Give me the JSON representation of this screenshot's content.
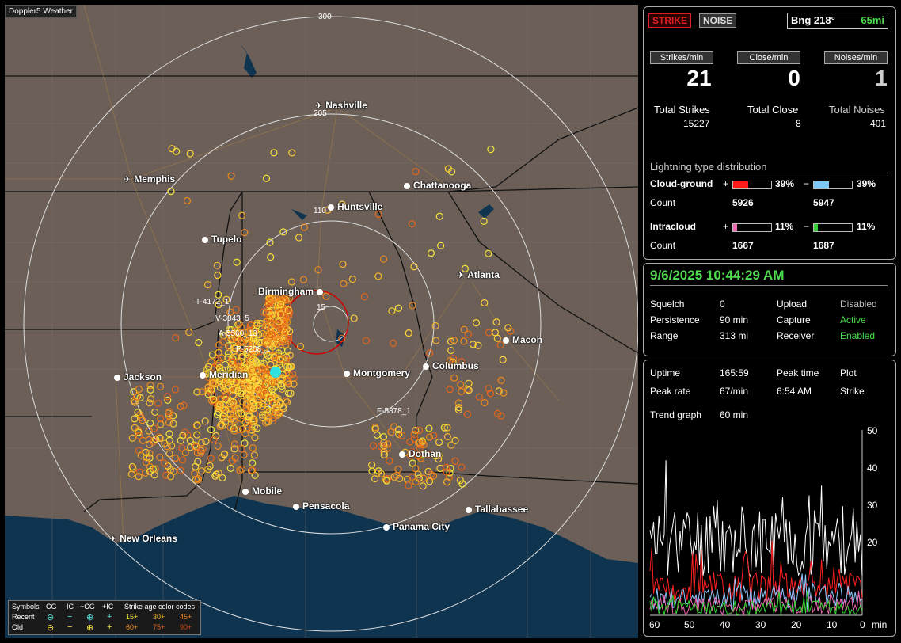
{
  "map": {
    "title": "Doppler5 Weather",
    "ring_labels": [
      "300",
      "205",
      "110",
      "15"
    ],
    "cities": [
      {
        "name": "Nashville",
        "kind": "airport"
      },
      {
        "name": "Memphis",
        "kind": "airport"
      },
      {
        "name": "Chattanooga",
        "kind": "city"
      },
      {
        "name": "Huntsville",
        "kind": "city"
      },
      {
        "name": "Tupelo",
        "kind": "city"
      },
      {
        "name": "Atlanta",
        "kind": "airport"
      },
      {
        "name": "Birmingham",
        "kind": "city"
      },
      {
        "name": "Macon",
        "kind": "city"
      },
      {
        "name": "Jackson",
        "kind": "city"
      },
      {
        "name": "Meridian",
        "kind": "city"
      },
      {
        "name": "Montgomery",
        "kind": "city"
      },
      {
        "name": "Columbus",
        "kind": "city"
      },
      {
        "name": "Dothan",
        "kind": "city"
      },
      {
        "name": "Mobile",
        "kind": "city"
      },
      {
        "name": "Pensacola",
        "kind": "city"
      },
      {
        "name": "Tallahassee",
        "kind": "city"
      },
      {
        "name": "Panama City",
        "kind": "city"
      },
      {
        "name": "New Orleans",
        "kind": "airport"
      }
    ],
    "storm_labels": [
      "T-4172_1",
      "V-3043_5",
      "A-5560_13",
      "P-5208_1",
      "F-5878_1"
    ]
  },
  "legend": {
    "symbols_label": "Symbols",
    "col_headers": [
      "-CG",
      "-IC",
      "+CG",
      "+IC"
    ],
    "age_title": "Strike age color codes",
    "recent_label": "Recent",
    "old_label": "Old",
    "recent_ages": [
      "15+",
      "30+",
      "45+"
    ],
    "old_ages": [
      "60+",
      "75+",
      "90+"
    ],
    "recent_symbols": [
      "⊖",
      "−",
      "⊕",
      "+"
    ],
    "old_symbols": [
      "⊖",
      "−",
      "⊕",
      "+"
    ]
  },
  "top": {
    "strike_btn": "STRIKE",
    "noise_btn": "NOISE",
    "bearing": "Bng 218°",
    "distance": "65mi",
    "headers": [
      "Strikes/min",
      "Close/min",
      "Noises/min"
    ],
    "rates": [
      "21",
      "0",
      "1"
    ],
    "total_labels": [
      "Total Strikes",
      "Total Close",
      "Total Noises"
    ],
    "totals": [
      "15227",
      "8",
      "401"
    ],
    "dist_title": "Lightning type distribution",
    "cg_label": "Cloud-ground",
    "ic_label": "Intracloud",
    "count_label": "Count",
    "plus": "+",
    "minus": "−",
    "cg_pos_pct": "39%",
    "cg_neg_pct": "39%",
    "cg_pos_count": "5926",
    "cg_neg_count": "5947",
    "ic_pos_pct": "11%",
    "ic_neg_pct": "11%",
    "ic_pos_count": "1667",
    "ic_neg_count": "1687",
    "bar_levels": {
      "cg_pos": 0.39,
      "cg_neg": 0.39,
      "ic_pos": 0.11,
      "ic_neg": 0.11
    },
    "bar_colors": {
      "cg_pos": "#ff1a1a",
      "cg_neg": "#7ec8f7",
      "ic_pos": "#f06ab0",
      "ic_neg": "#2ed12e"
    }
  },
  "status": {
    "datetime": "9/6/2025 10:44:29 AM",
    "squelch_label": "Squelch",
    "squelch": "0",
    "persistence_label": "Persistence",
    "persistence": "90 min",
    "range_label": "Range",
    "range": "313 mi",
    "upload_label": "Upload",
    "upload": "Disabled",
    "capture_label": "Capture",
    "capture": "Active",
    "receiver_label": "Receiver",
    "receiver": "Enabled"
  },
  "trend": {
    "uptime_label": "Uptime",
    "uptime": "165:59",
    "peak_time_label": "Peak time",
    "peak_time": "6:54 AM",
    "plot_label": "Plot",
    "peak_rate_label": "Peak rate",
    "peak_rate": "67/min",
    "plot_value": "Strike",
    "trend_label": "Trend graph",
    "trend_value": "60 min",
    "y_ticks": [
      "50",
      "40",
      "30",
      "20"
    ],
    "x_ticks": [
      "60",
      "50",
      "40",
      "30",
      "20",
      "10",
      "0"
    ],
    "x_unit": "min"
  }
}
